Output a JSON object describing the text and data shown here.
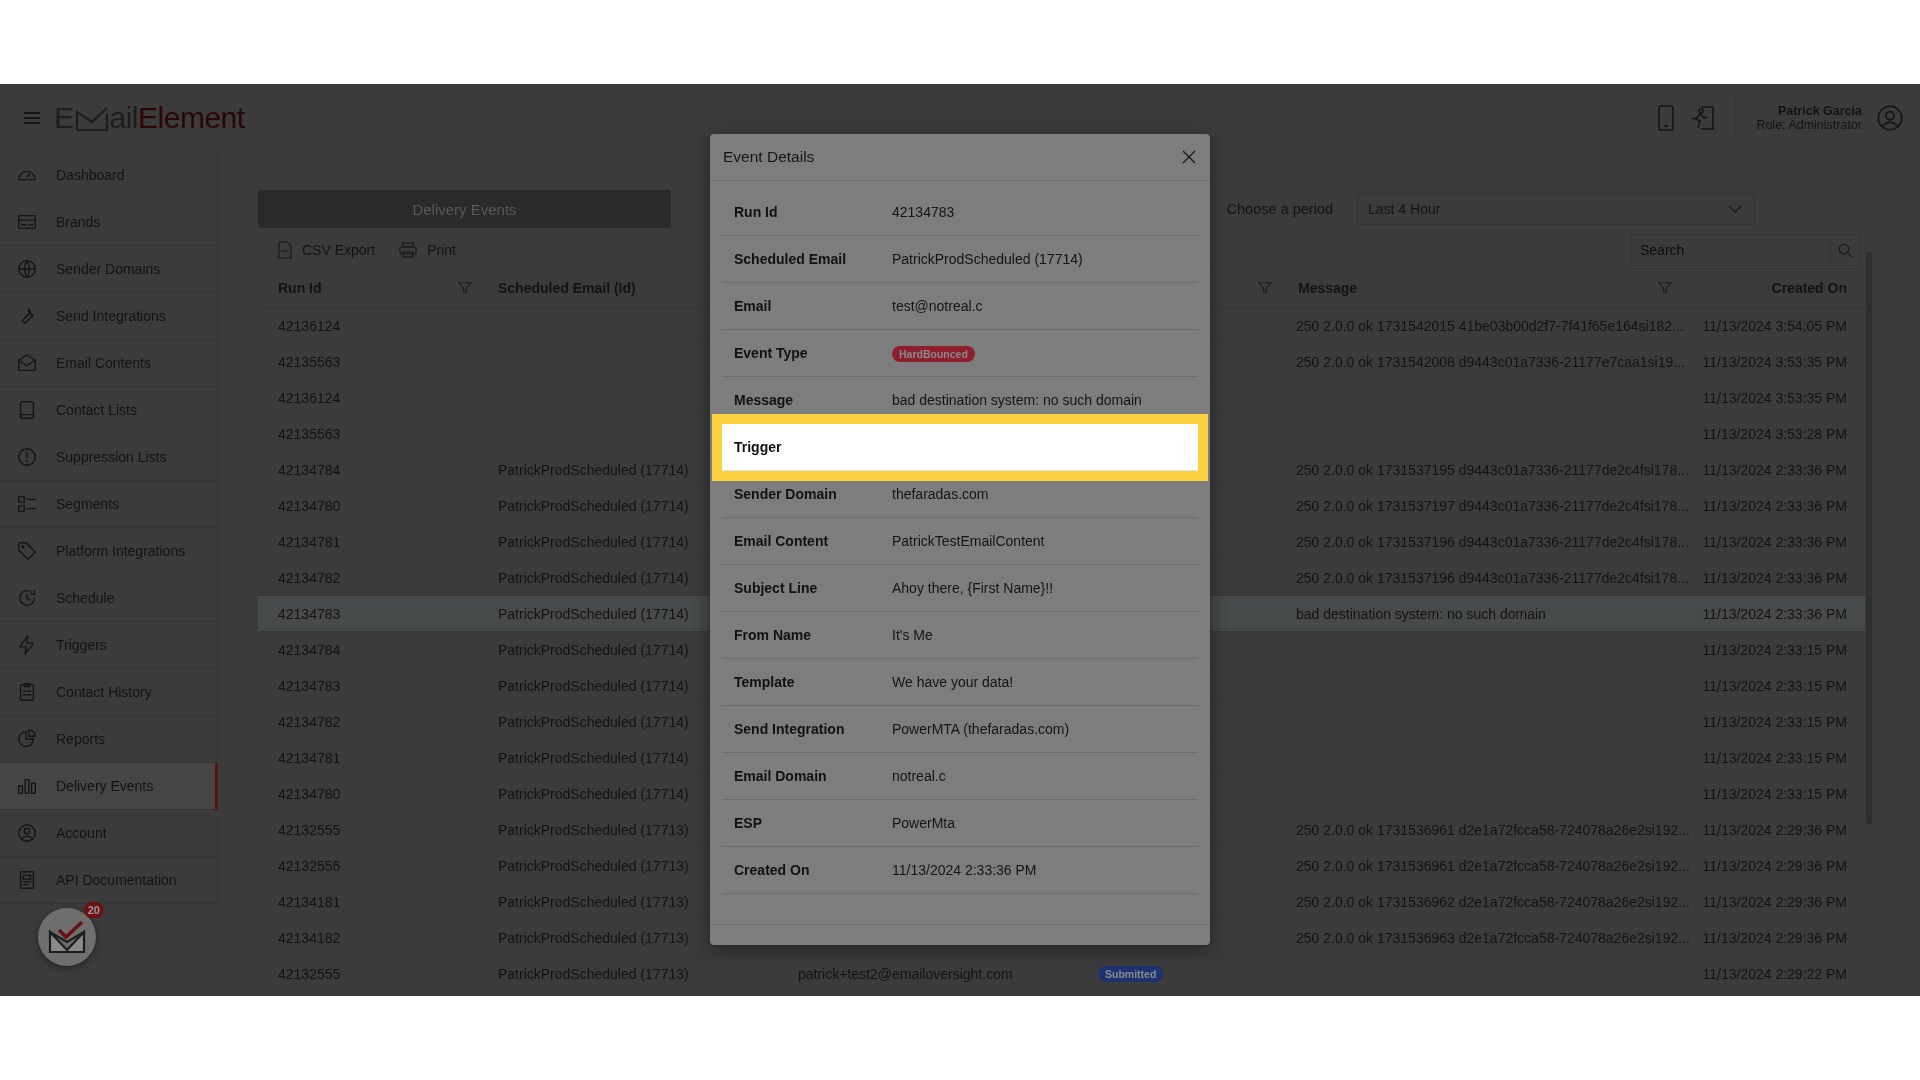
{
  "header": {
    "logo": {
      "lead": "E",
      "body": "ail",
      "accent": "Element"
    },
    "user": {
      "name": "Patrick Garcia",
      "role": "Role: Administrator"
    }
  },
  "sidebar": {
    "items": [
      {
        "label": "Dashboard",
        "selected": false
      },
      {
        "label": "Brands",
        "selected": false
      },
      {
        "label": "Sender Domains",
        "selected": false
      },
      {
        "label": "Send Integrations",
        "selected": false
      },
      {
        "label": "Email Contents",
        "selected": false
      },
      {
        "label": "Contact Lists",
        "selected": false
      },
      {
        "label": "Suppression Lists",
        "selected": false
      },
      {
        "label": "Segments",
        "selected": false
      },
      {
        "label": "Platform Integrations",
        "selected": false
      },
      {
        "label": "Schedule",
        "selected": false
      },
      {
        "label": "Triggers",
        "selected": false
      },
      {
        "label": "Contact History",
        "selected": false
      },
      {
        "label": "Reports",
        "selected": false
      },
      {
        "label": "Delivery Events",
        "selected": true
      },
      {
        "label": "Account",
        "selected": false
      },
      {
        "label": "API Documentation",
        "selected": false
      }
    ],
    "notification_count": "20"
  },
  "panel": {
    "title": "Delivery Events",
    "toolbar": [
      "CSV Export",
      "Print"
    ],
    "period_label": "Choose a period",
    "period_value": "Last 4 Hour",
    "search": {
      "placeholder": "Search"
    }
  },
  "table": {
    "columns": [
      {
        "label": "Run Id",
        "filter": true
      },
      {
        "label": "Scheduled Email (Id)"
      },
      {},
      {
        "filter": true
      },
      {
        "label": "Message",
        "filter": true
      },
      {
        "label": "Created On",
        "filter": false
      }
    ],
    "rows": [
      {
        "run_id": "42136124",
        "message": "250 2.0.0 ok 1731542015 41be03b00d2f7-7f41f65e164si182...",
        "created_on": "11/13/2024 3:54:05 PM",
        "selected": false
      },
      {
        "run_id": "42135563",
        "message": "250 2.0.0 ok 1731542008 d9443c01a7336-21177e7caa1si19...",
        "created_on": "11/13/2024 3:53:35 PM",
        "selected": false
      },
      {
        "run_id": "42136124",
        "created_on": "11/13/2024 3:53:35 PM",
        "selected": false
      },
      {
        "run_id": "42135563",
        "created_on": "11/13/2024 3:53:28 PM",
        "selected": false
      },
      {
        "run_id": "42134784",
        "scheduled_email": "PatrickProdScheduled (17714)",
        "message": "250 2.0.0 ok 1731537195 d9443c01a7336-21177de2c4fsi178...",
        "created_on": "11/13/2024 2:33:36 PM",
        "selected": false
      },
      {
        "run_id": "42134780",
        "scheduled_email": "PatrickProdScheduled (17714)",
        "message": "250 2.0.0 ok 1731537197 d9443c01a7336-21177de2c4fsi178...",
        "created_on": "11/13/2024 2:33:36 PM",
        "selected": false
      },
      {
        "run_id": "42134781",
        "scheduled_email": "PatrickProdScheduled (17714)",
        "message": "250 2.0.0 ok 1731537196 d9443c01a7336-21177de2c4fsi178...",
        "created_on": "11/13/2024 2:33:36 PM",
        "selected": false
      },
      {
        "run_id": "42134782",
        "scheduled_email": "PatrickProdScheduled (17714)",
        "message": "250 2.0.0 ok 1731537196 d9443c01a7336-21177de2c4fsi178...",
        "created_on": "11/13/2024 2:33:36 PM",
        "selected": false
      },
      {
        "run_id": "42134783",
        "scheduled_email": "PatrickProdScheduled (17714)",
        "message": "bad destination system: no such domain",
        "created_on": "11/13/2024 2:33:36 PM",
        "selected": true
      },
      {
        "run_id": "42134784",
        "scheduled_email": "PatrickProdScheduled (17714)",
        "created_on": "11/13/2024 2:33:15 PM",
        "selected": false
      },
      {
        "run_id": "42134783",
        "scheduled_email": "PatrickProdScheduled (17714)",
        "created_on": "11/13/2024 2:33:15 PM",
        "selected": false
      },
      {
        "run_id": "42134782",
        "scheduled_email": "PatrickProdScheduled (17714)",
        "created_on": "11/13/2024 2:33:15 PM",
        "selected": false
      },
      {
        "run_id": "42134781",
        "scheduled_email": "PatrickProdScheduled (17714)",
        "created_on": "11/13/2024 2:33:15 PM",
        "selected": false
      },
      {
        "run_id": "42134780",
        "scheduled_email": "PatrickProdScheduled (17714)",
        "created_on": "11/13/2024 2:33:15 PM",
        "selected": false
      },
      {
        "run_id": "42132555",
        "scheduled_email": "PatrickProdScheduled (17713)",
        "message": "250 2.0.0 ok 1731536961 d2e1a72fcca58-724078a26e2si192...",
        "created_on": "11/13/2024 2:29:36 PM",
        "selected": false
      },
      {
        "run_id": "42132556",
        "scheduled_email": "PatrickProdScheduled (17713)",
        "message": "250 2.0.0 ok 1731536961 d2e1a72fcca58-724078a26e2si192...",
        "created_on": "11/13/2024 2:29:36 PM",
        "selected": false
      },
      {
        "run_id": "42134181",
        "scheduled_email": "PatrickProdScheduled (17713)",
        "message": "250 2.0.0 ok 1731536962 d2e1a72fcca58-724078a26e2si192...",
        "created_on": "11/13/2024 2:29:36 PM",
        "selected": false
      },
      {
        "run_id": "42134182",
        "scheduled_email": "PatrickProdScheduled (17713)",
        "message": "250 2.0.0 ok 1731536963 d2e1a72fcca58-724078a26e2si192...",
        "created_on": "11/13/2024 2:29:36 PM",
        "selected": false
      },
      {
        "run_id": "42132555",
        "scheduled_email": "PatrickProdScheduled (17713)",
        "email": "patrick+test2@emailoversight.com",
        "event_type": {
          "label": "Submitted",
          "color": "#1d3270"
        },
        "created_on": "11/13/2024 2:29:22 PM",
        "selected": false
      }
    ]
  },
  "dialog": {
    "title": "Event Details",
    "fields": [
      {
        "label": "Run Id",
        "value": "42134783",
        "highlighted": false
      },
      {
        "label": "Scheduled Email",
        "value": "PatrickProdScheduled (17714)",
        "highlighted": false
      },
      {
        "label": "Email",
        "value": "test@notreal.c",
        "highlighted": false
      },
      {
        "label": "Event Type",
        "badge": {
          "label": "HardBounced",
          "color": "#8c1f2b"
        },
        "highlighted": false
      },
      {
        "label": "Message",
        "value": "bad destination system: no such domain",
        "highlighted": false
      },
      {
        "label": "Trigger",
        "highlighted": true
      },
      {
        "label": "Sender Domain",
        "value": "thefaradas.com",
        "highlighted": false
      },
      {
        "label": "Email Content",
        "value": "PatrickTestEmailContent",
        "highlighted": false
      },
      {
        "label": "Subject Line",
        "value": "Ahoy there, {First Name}!!",
        "highlighted": false
      },
      {
        "label": "From Name",
        "value": "It's Me",
        "highlighted": false
      },
      {
        "label": "Template",
        "value": "We have your data!",
        "highlighted": false
      },
      {
        "label": "Send Integration",
        "value": "PowerMTA (thefaradas.com)",
        "highlighted": false
      },
      {
        "label": "Email Domain",
        "value": "notreal.c",
        "highlighted": false
      },
      {
        "label": "ESP",
        "value": "PowerMta",
        "highlighted": false
      },
      {
        "label": "Created On",
        "value": "11/13/2024 2:33:36 PM",
        "highlighted": false
      }
    ]
  }
}
